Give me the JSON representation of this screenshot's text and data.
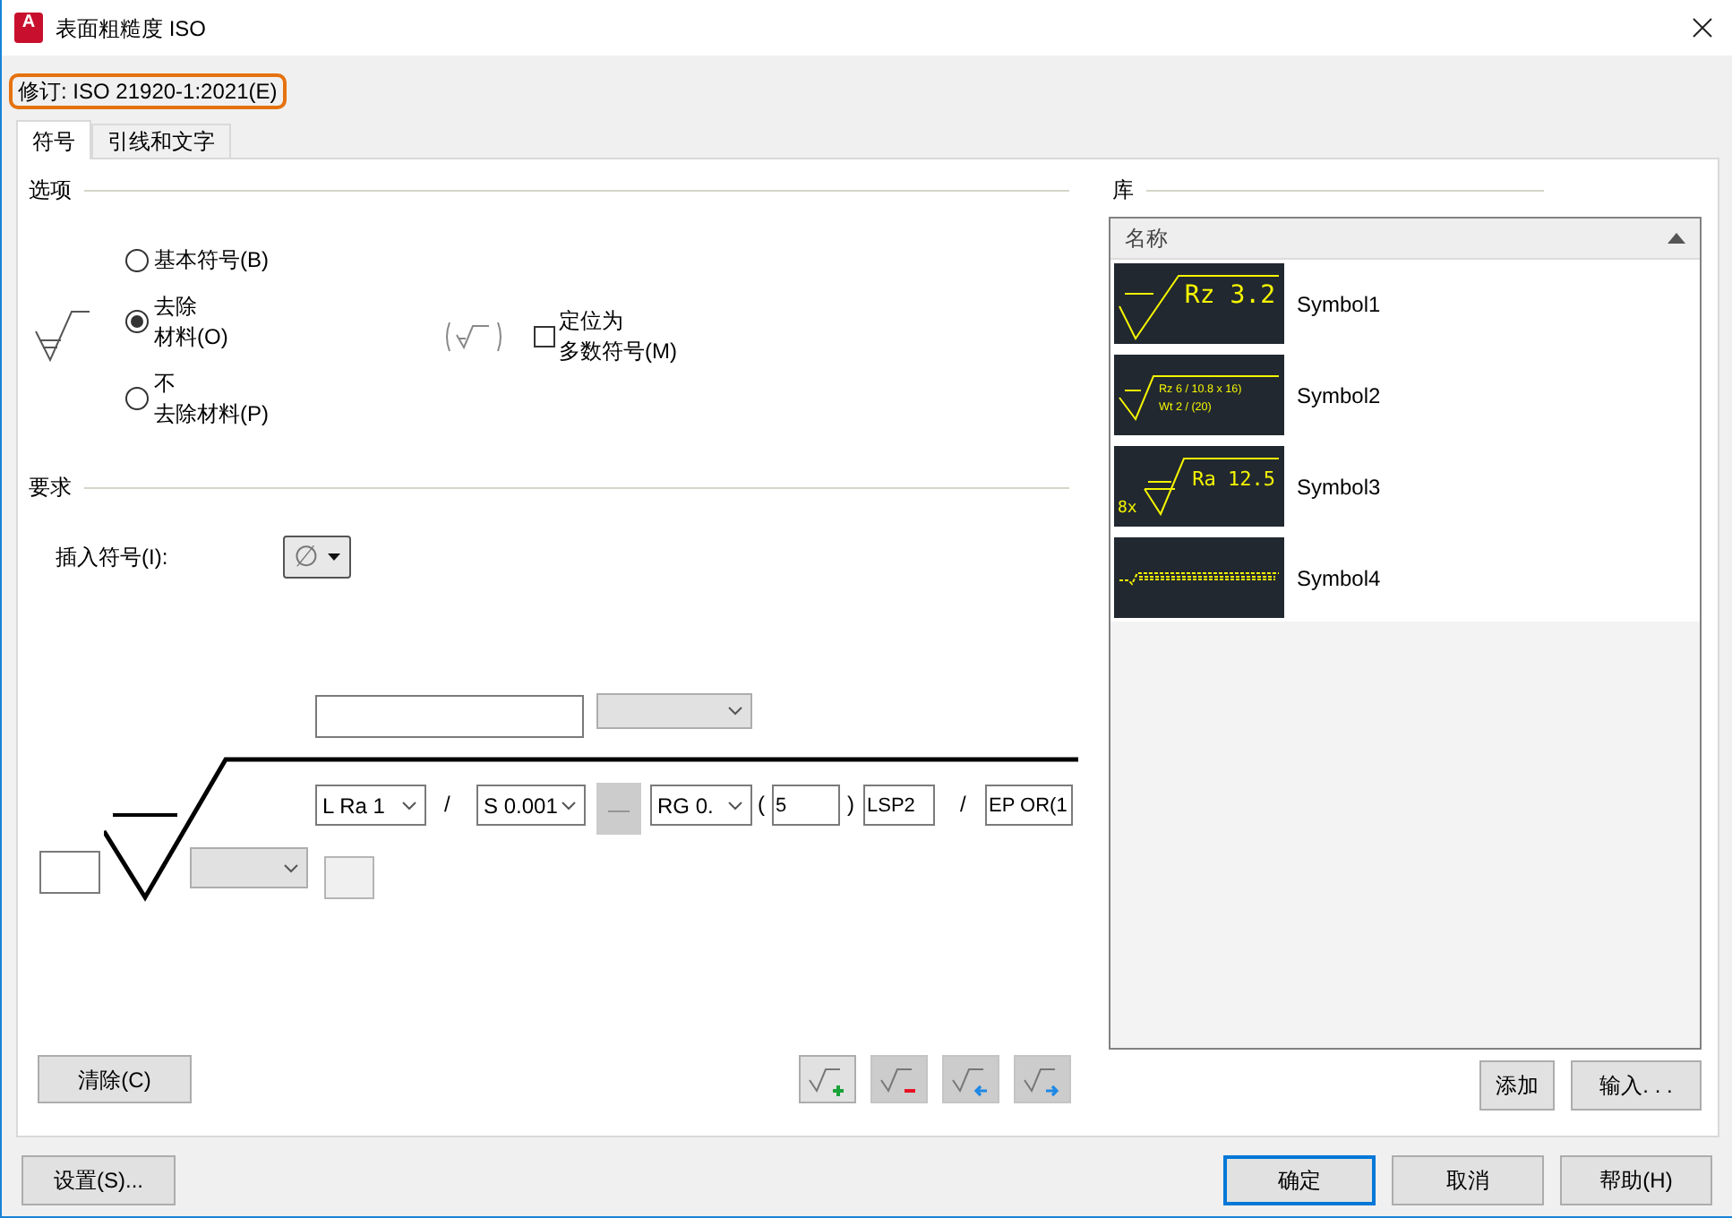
{
  "window": {
    "title": "表面粗糙度 ISO",
    "app_icon": "A"
  },
  "revision": "修订: ISO 21920-1:2021(E)",
  "tabs": [
    {
      "label": "符号",
      "selected": true
    },
    {
      "label": "引线和文字",
      "selected": false
    }
  ],
  "options": {
    "title": "选项",
    "radios": [
      {
        "lines": [
          "基本符号(B)"
        ],
        "selected": false
      },
      {
        "lines": [
          "去除",
          "材料(O)"
        ],
        "selected": true
      },
      {
        "lines": [
          "不",
          "去除材料(P)"
        ],
        "selected": false
      }
    ],
    "checkbox": {
      "lines": [
        "定位为",
        "多数符号(M)"
      ],
      "checked": false
    }
  },
  "requirements": {
    "title": "要求",
    "insert_label": "插入符号(I):",
    "insert_value": "∅",
    "fields": [
      {
        "kind": "input",
        "disabled": false
      },
      {
        "kind": "combo",
        "disabled": true
      },
      {
        "kind": "combo",
        "value": "L Ra 1",
        "disabled": false
      },
      {
        "kind": "text",
        "value": "/"
      },
      {
        "kind": "combo",
        "value": "S 0.001",
        "disabled": false
      },
      {
        "kind": "button",
        "value": "—",
        "disabled": true
      },
      {
        "kind": "combo",
        "value": "RG 0.",
        "disabled": false
      },
      {
        "kind": "text",
        "value": "("
      },
      {
        "kind": "input",
        "value": "5",
        "disabled": false
      },
      {
        "kind": "text",
        "value": ")"
      },
      {
        "kind": "input",
        "value": "LSP2",
        "disabled": false
      },
      {
        "kind": "text",
        "value": "/"
      },
      {
        "kind": "input",
        "value": "EP OR(1",
        "disabled": false
      },
      {
        "kind": "input",
        "disabled": false
      },
      {
        "kind": "combo",
        "disabled": true
      },
      {
        "kind": "input",
        "disabled": true
      }
    ],
    "clear_button": "清除(C)",
    "symbol_buttons": [
      {
        "kind": "add",
        "disabled": false
      },
      {
        "kind": "remove",
        "disabled": true
      },
      {
        "kind": "left",
        "disabled": true
      },
      {
        "kind": "right",
        "disabled": true
      }
    ]
  },
  "library": {
    "title": "库",
    "column": "名称",
    "items": [
      {
        "name": "Symbol1",
        "preview": {
          "kind": "single",
          "texts": [
            "Rz 3.2"
          ]
        }
      },
      {
        "name": "Symbol2",
        "preview": {
          "kind": "double",
          "texts": [
            "Rz 6 / 10.8 x 16)",
            "Wt 2 / (20)"
          ]
        }
      },
      {
        "name": "Symbol3",
        "preview": {
          "kind": "prefixed",
          "texts": [
            "8x",
            "Ra 12.5"
          ]
        }
      },
      {
        "name": "Symbol4",
        "preview": {
          "kind": "long"
        }
      }
    ],
    "buttons": [
      "添加",
      "输入. . ."
    ]
  },
  "footer": {
    "settings": "设置(S)...",
    "buttons": [
      {
        "label": "确定",
        "default": true
      },
      {
        "label": "取消",
        "default": false
      },
      {
        "label": "帮助(H)",
        "default": false
      }
    ]
  }
}
